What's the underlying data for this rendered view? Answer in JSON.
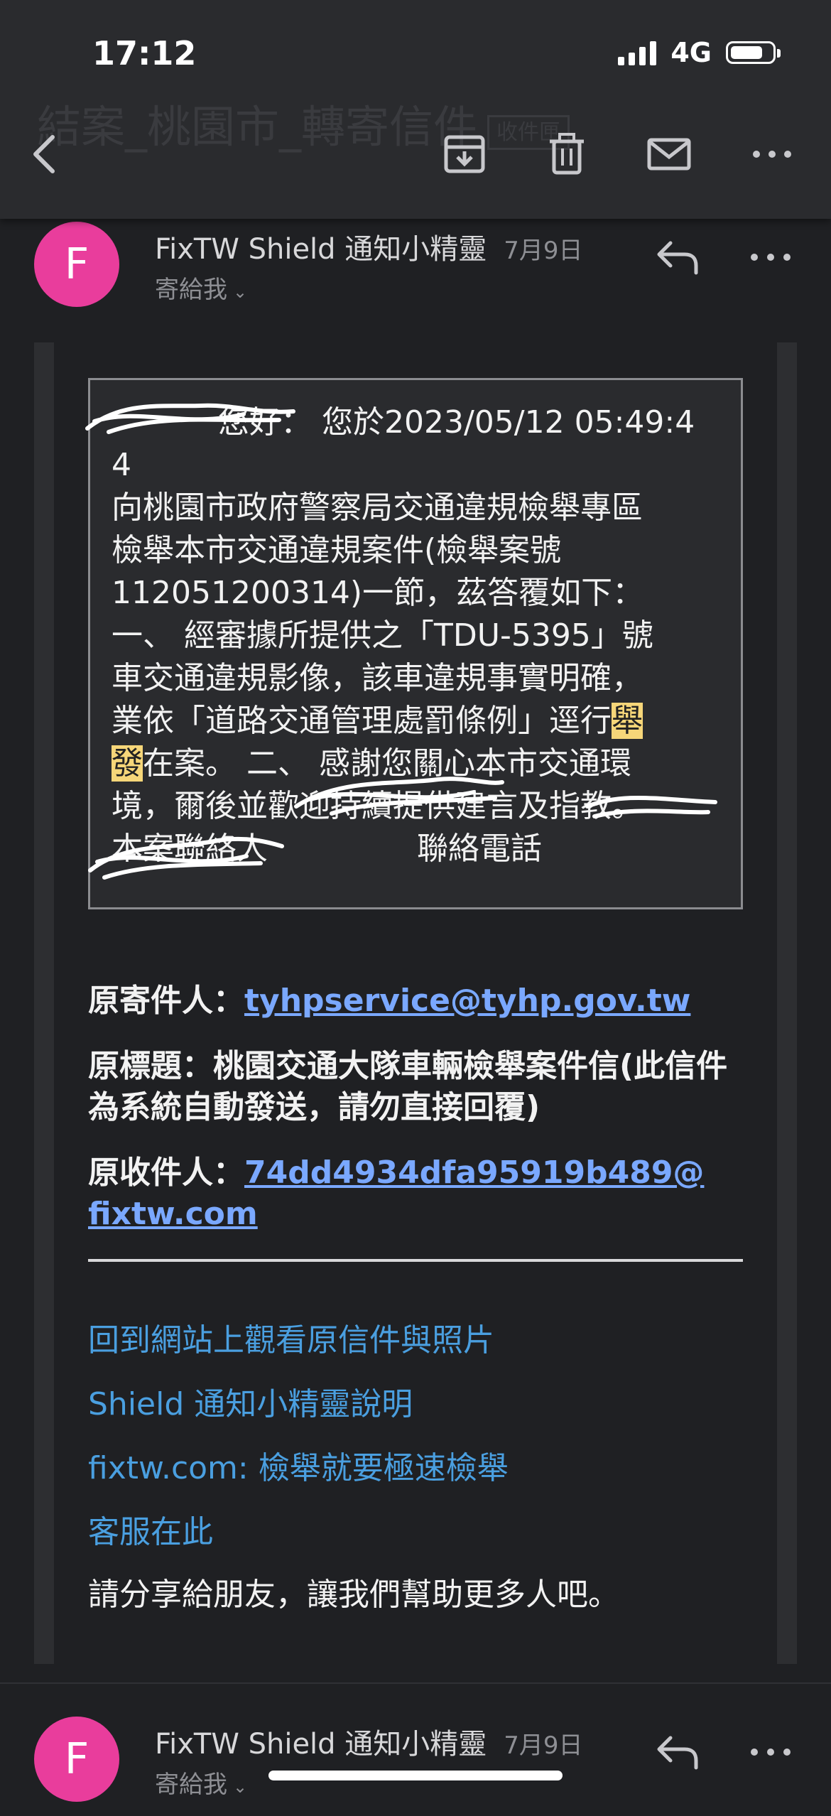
{
  "status_bar": {
    "time": "17:12",
    "network": "4G"
  },
  "toolbar": {
    "subject_ghost": "結案_桃園市_轉寄信件",
    "subject_tag": "收件匣"
  },
  "message": {
    "avatar_letter": "F",
    "sender": "FixTW Shield 通知小精靈",
    "date": "7月9日",
    "recipient": "寄給我",
    "quote": {
      "greeting": "您好：",
      "line1": "您於2023/05/12 05:49:44",
      "line2": "向桃園市政府警察局交通違規檢舉專區",
      "line3": "檢舉本市交通違規案件(檢舉案號",
      "line4": "112051200314)一節，茲答覆如下：",
      "line5": "一、 經審據所提供之「TDU-5395」號",
      "line6": "車交通違規影像，該車違規事實明確，",
      "line7a": "業依「道路交通管理處罰條例」逕行",
      "line7b": "舉",
      "line8a": "發",
      "line8b": "在案。 二、 感謝您關心本市交通環",
      "line9": "境，爾後並歡迎持續提供建言及指教。",
      "line10a": "本案聯絡人",
      "line10b": "聯絡電話"
    },
    "original_sender_label": "原寄件人：",
    "original_sender": "tyhpservice@tyhp.gov.tw",
    "original_subject_label": "原標題：",
    "original_subject": "桃園交通大隊車輛檢舉案件信(此信件為系統自動發送，請勿直接回覆)",
    "original_recipient_label": "原收件人：",
    "original_recipient_line1": "74dd4934dfa95919b489@",
    "original_recipient_line2": "fixtw.com",
    "links": [
      "回到網站上觀看原信件與照片",
      "Shield 通知小精靈說明",
      "fixtw.com: 檢舉就要極速檢舉",
      "客服在此"
    ],
    "share_text": "請分享給朋友，讓我們幫助更多人吧。"
  },
  "next_message": {
    "avatar_letter": "F",
    "sender": "FixTW Shield 通知小精靈",
    "date": "7月9日",
    "recipient": "寄給我"
  },
  "colors": {
    "avatar": "#e93d9c",
    "link": "#4a9fe0",
    "email_link": "#7aa8ff",
    "highlight": "#f6d679"
  },
  "icons": [
    "back-arrow-icon",
    "archive-icon",
    "trash-icon",
    "mail-icon",
    "more-icon",
    "reply-icon",
    "chevron-down-icon"
  ]
}
